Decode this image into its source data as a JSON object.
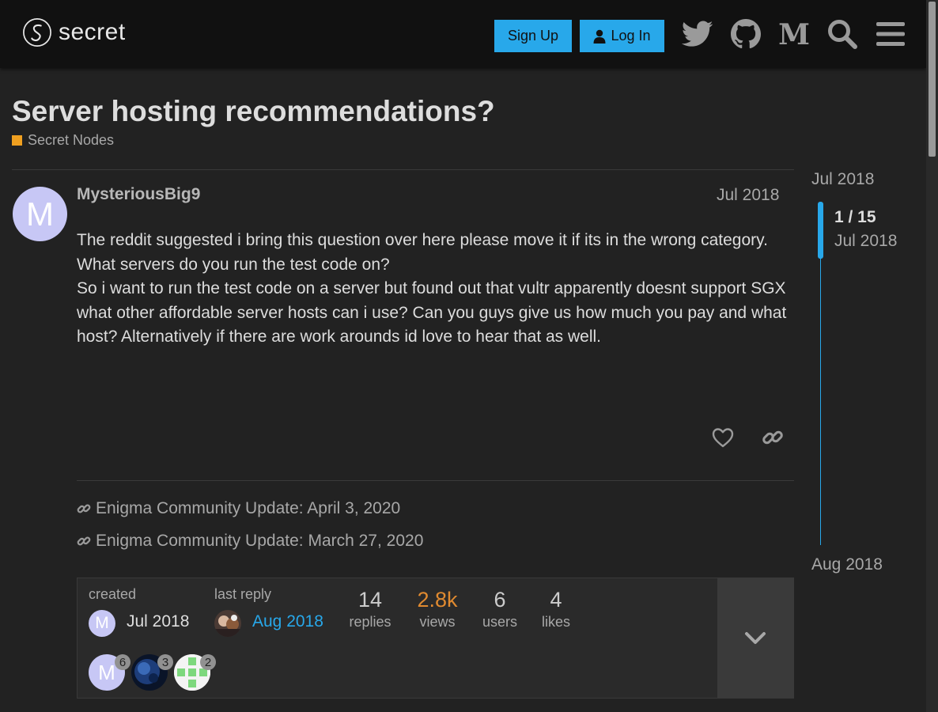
{
  "header": {
    "logo_text": "secret",
    "signup_label": "Sign Up",
    "login_label": "Log In",
    "icons": [
      "twitter-icon",
      "github-icon",
      "medium-icon",
      "search-icon",
      "hamburger-menu-icon"
    ]
  },
  "topic": {
    "title": "Server hosting recommendations?",
    "category": "Secret Nodes",
    "category_color": "#f0a020"
  },
  "post": {
    "avatar_letter": "M",
    "username": "MysteriousBig9",
    "date": "Jul 2018",
    "paragraphs": [
      "The reddit suggested i bring this question over here please move it if its in the wrong category.",
      "What servers do you run the test code on?",
      "So i want to run the test code on a server but found out that vultr apparently doesnt support SGX what other affordable server hosts can i use? Can you guys give us how much you pay and what host? Alternatively if there are work arounds id love to hear that as well."
    ]
  },
  "linkbacks": [
    "Enigma Community Update: April 3, 2020",
    "Enigma Community Update: March 27, 2020"
  ],
  "topic_map": {
    "created_label": "created",
    "created_date": "Jul 2018",
    "created_avatar_letter": "M",
    "last_reply_label": "last reply",
    "last_reply_date": "Aug 2018",
    "stats": [
      {
        "num": "14",
        "label": "replies"
      },
      {
        "num": "2.8k",
        "label": "views"
      },
      {
        "num": "6",
        "label": "users"
      },
      {
        "num": "4",
        "label": "likes"
      }
    ],
    "participants": [
      {
        "letter": "M",
        "count": "6"
      },
      {
        "letter": "",
        "count": "3"
      },
      {
        "letter": "",
        "count": "2"
      }
    ]
  },
  "timeline": {
    "start_date": "Jul 2018",
    "position": "1 / 15",
    "position_date": "Jul 2018",
    "end_date": "Aug 2018"
  },
  "colors": {
    "accent": "#28a8ea",
    "views_highlight": "#e08a30"
  }
}
